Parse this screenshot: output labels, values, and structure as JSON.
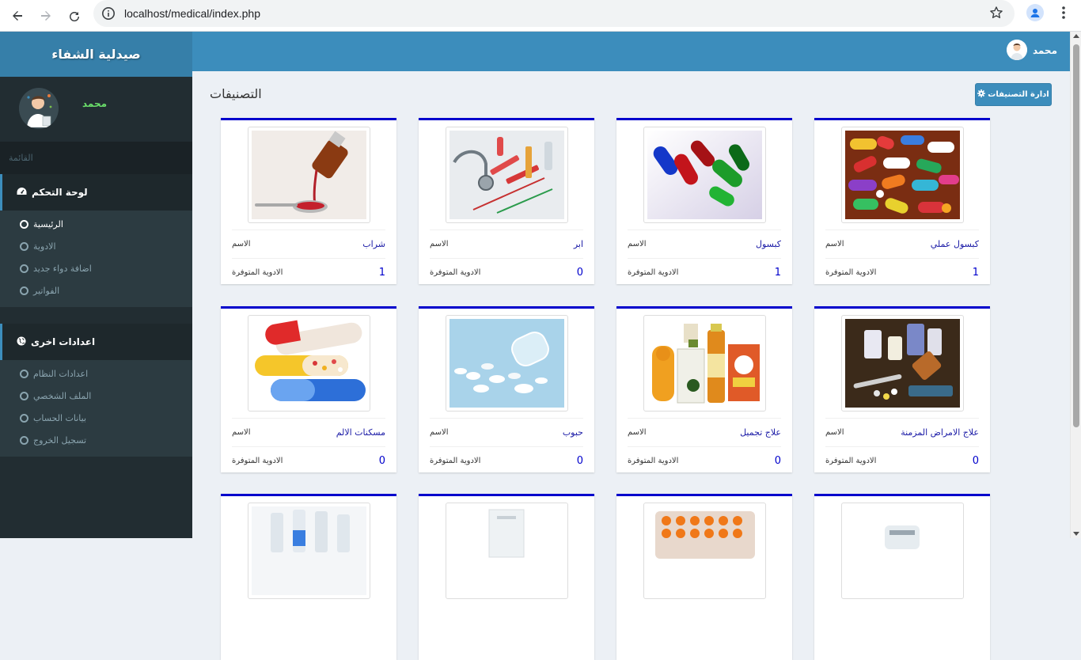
{
  "browser": {
    "url": "localhost/medical/index.php"
  },
  "sidebar": {
    "brand": "صيدلية الشفاء",
    "user_name": "محمد",
    "menu_header": "القائمة",
    "sections": [
      {
        "title": "لوحة التحكم",
        "items": [
          {
            "label": "الرئيسية",
            "active": true
          },
          {
            "label": "الادوية",
            "active": false
          },
          {
            "label": "اضافة دواء جديد",
            "active": false
          },
          {
            "label": "الفواتير",
            "active": false
          }
        ]
      },
      {
        "title": "اعدادات اخرى",
        "items": [
          {
            "label": "اعدادات النظام",
            "active": false
          },
          {
            "label": "الملف الشخصي",
            "active": false
          },
          {
            "label": "بيانات الحساب",
            "active": false
          },
          {
            "label": "تسجيل الخروج",
            "active": false
          }
        ]
      }
    ]
  },
  "header": {
    "user_name": "محمد"
  },
  "main": {
    "title": "التصنيفات",
    "manage_button": "ادارة التصنيفات",
    "name_label": "الاسم",
    "available_label": "الادوية المتوفرة",
    "categories": [
      {
        "name": "كبسول عملي",
        "count": "1"
      },
      {
        "name": "كبسول",
        "count": "1"
      },
      {
        "name": "ابر",
        "count": "0"
      },
      {
        "name": "شراب",
        "count": "1"
      },
      {
        "name": "علاج الامراض المزمنة",
        "count": "0"
      },
      {
        "name": "علاج تجميل",
        "count": "0"
      },
      {
        "name": "حبوب",
        "count": "0"
      },
      {
        "name": "مسكنات الالم",
        "count": "0"
      }
    ]
  },
  "colors": {
    "accent": "#3c8dbc",
    "card_border": "#0000cc",
    "sidebar_bg": "#222d32"
  }
}
